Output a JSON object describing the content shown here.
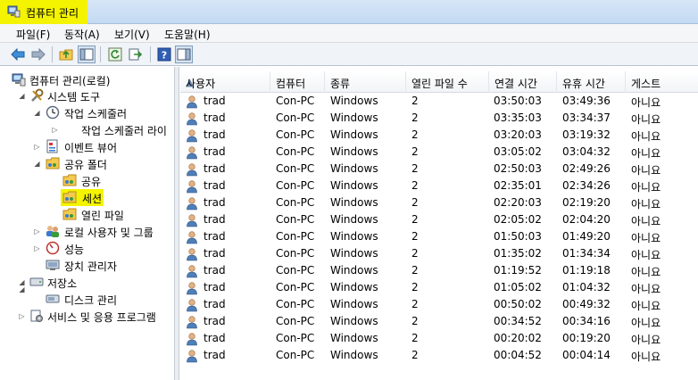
{
  "window": {
    "title": "컴퓨터 관리",
    "highlight_color": "#f4f400"
  },
  "menu": [
    "파일(F)",
    "동작(A)",
    "보기(V)",
    "도움말(H)"
  ],
  "toolbar": {
    "buttons": [
      "back-arrow-icon",
      "forward-arrow-icon",
      "up-folder-icon",
      "show-hide-tree-icon",
      "refresh-icon",
      "export-list-icon",
      "help-icon",
      "properties-pane-icon"
    ]
  },
  "tree": {
    "root": "컴퓨터 관리(로컬)",
    "system_tools": "시스템 도구",
    "task_scheduler": "작업 스케줄러",
    "task_scheduler_lib": "작업 스케줄러 라이",
    "event_viewer": "이벤트 뷰어",
    "shared_folders": "공유 폴더",
    "shares": "공유",
    "sessions": "세션",
    "open_files": "열린 파일",
    "local_users": "로컬 사용자 및 그룹",
    "performance": "성능",
    "device_manager": "장치 관리자",
    "storage": "저장소",
    "disk_management": "디스크 관리",
    "services_apps": "서비스 및 응용 프로그램"
  },
  "list": {
    "columns": [
      "사용자",
      "컴퓨터",
      "종류",
      "열린 파일 수",
      "연결 시간",
      "유휴 시간",
      "게스트"
    ],
    "rows": [
      [
        "trad",
        "Con-PC",
        "Windows",
        "2",
        "03:50:03",
        "03:49:36",
        "아니요"
      ],
      [
        "trad",
        "Con-PC",
        "Windows",
        "2",
        "03:35:03",
        "03:34:37",
        "아니요"
      ],
      [
        "trad",
        "Con-PC",
        "Windows",
        "2",
        "03:20:03",
        "03:19:32",
        "아니요"
      ],
      [
        "trad",
        "Con-PC",
        "Windows",
        "2",
        "03:05:02",
        "03:04:32",
        "아니요"
      ],
      [
        "trad",
        "Con-PC",
        "Windows",
        "2",
        "02:50:03",
        "02:49:26",
        "아니요"
      ],
      [
        "trad",
        "Con-PC",
        "Windows",
        "2",
        "02:35:01",
        "02:34:26",
        "아니요"
      ],
      [
        "trad",
        "Con-PC",
        "Windows",
        "2",
        "02:20:03",
        "02:19:20",
        "아니요"
      ],
      [
        "trad",
        "Con-PC",
        "Windows",
        "2",
        "02:05:02",
        "02:04:20",
        "아니요"
      ],
      [
        "trad",
        "Con-PC",
        "Windows",
        "2",
        "01:50:03",
        "01:49:20",
        "아니요"
      ],
      [
        "trad",
        "Con-PC",
        "Windows",
        "2",
        "01:35:02",
        "01:34:34",
        "아니요"
      ],
      [
        "trad",
        "Con-PC",
        "Windows",
        "2",
        "01:19:52",
        "01:19:18",
        "아니요"
      ],
      [
        "trad",
        "Con-PC",
        "Windows",
        "2",
        "01:05:02",
        "01:04:32",
        "아니요"
      ],
      [
        "trad",
        "Con-PC",
        "Windows",
        "2",
        "00:50:02",
        "00:49:32",
        "아니요"
      ],
      [
        "trad",
        "Con-PC",
        "Windows",
        "2",
        "00:34:52",
        "00:34:16",
        "아니요"
      ],
      [
        "trad",
        "Con-PC",
        "Windows",
        "2",
        "00:20:02",
        "00:19:20",
        "아니요"
      ],
      [
        "trad",
        "Con-PC",
        "Windows",
        "2",
        "00:04:52",
        "00:04:14",
        "아니요"
      ]
    ]
  }
}
